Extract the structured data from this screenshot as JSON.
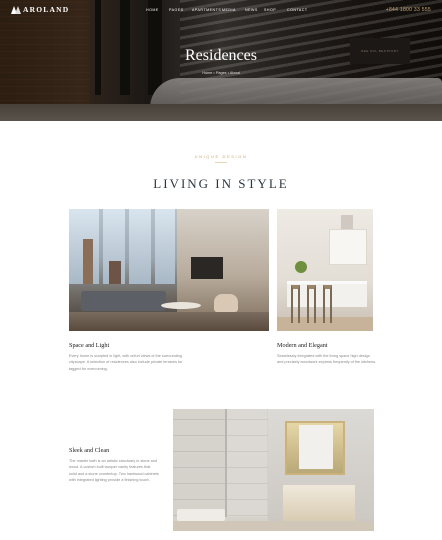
{
  "header": {
    "logo_text": "AROLAND",
    "menu": [
      "HOME",
      "PAGES",
      "APARTMENTS",
      "MEDIA",
      "NEWS",
      "SHOP",
      "CONTACT"
    ],
    "phone": "+844 1800 33 555"
  },
  "hero": {
    "title": "Residences",
    "breadcrumb": "Home • Pages • About",
    "screen_text": "REE RVL BESTPORT"
  },
  "section": {
    "eyebrow": "UNIQUE DESIGN",
    "title": "LIVING IN STYLE"
  },
  "features": [
    {
      "title": "Space and Light",
      "text": "Every home is sculpted in light, with unfurl views of the surrounding cityscape. A selection of residences also include private terraces for tagged for overcoming."
    },
    {
      "title": "Modern and Elegant",
      "text": "Seamlessly integrated with the living space high design and precisely woodwork express frequently of the kitchens."
    },
    {
      "title": "Sleek and Clean",
      "text": "The master bath is an artistic sanctuary in stone and wood. A custom built lacquer vanity features that solid and a stone countertop. Two hardwood cabinets with integrated lighting provide a finishing touch."
    }
  ]
}
